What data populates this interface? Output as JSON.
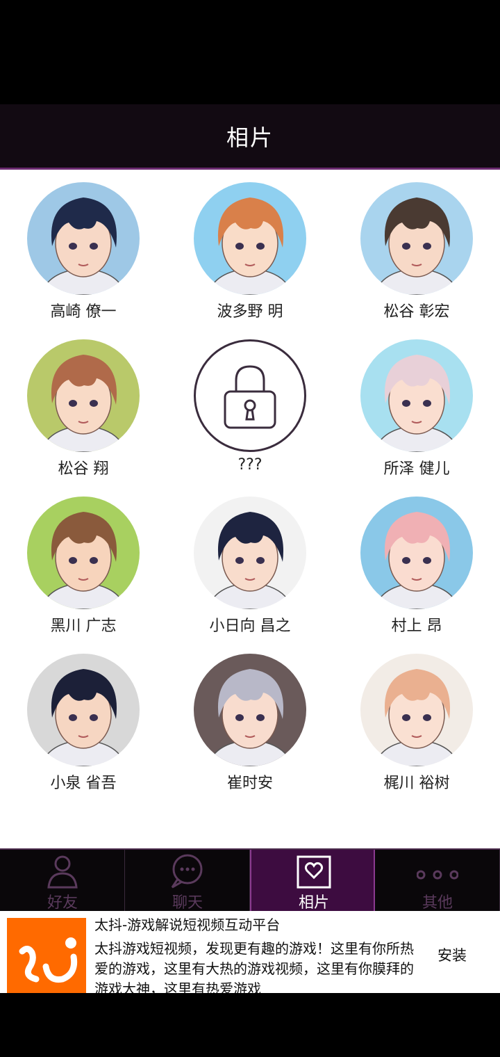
{
  "header": {
    "title": "相片"
  },
  "gallery": [
    {
      "name": "高崎 僚一",
      "hair": "#1f2a4a",
      "bg": "#9ec8e6",
      "skin": "#f7d8c6"
    },
    {
      "name": "波多野 明",
      "hair": "#d9804a",
      "bg": "#8fd0f0",
      "skin": "#f9dcc8"
    },
    {
      "name": "松谷 彰宏",
      "hair": "#4a3a32",
      "bg": "#a9d4ee",
      "skin": "#f7d9c7"
    },
    {
      "name": "松谷 翔",
      "hair": "#b06a4a",
      "bg": "#b9c96a",
      "skin": "#f8dac6"
    },
    {
      "name": "???",
      "locked": true
    },
    {
      "name": "所泽 健儿",
      "hair": "#e8d0d8",
      "bg": "#a8e0f0",
      "skin": "#faded0"
    },
    {
      "name": "黑川 广志",
      "hair": "#8a5a3c",
      "bg": "#a8d060",
      "skin": "#f7d4bc"
    },
    {
      "name": "小日向 昌之",
      "hair": "#1e2440",
      "bg": "#f2f2f2",
      "skin": "#f8dccc"
    },
    {
      "name": "村上 昂",
      "hair": "#f0b0b4",
      "bg": "#8ac8e8",
      "skin": "#fadcd0"
    },
    {
      "name": "小泉 省吾",
      "hair": "#1c2038",
      "bg": "#d8d8d8",
      "skin": "#f6d6c2"
    },
    {
      "name": "崔时安",
      "hair": "#b8b8c8",
      "bg": "#6a5a5a",
      "skin": "#f8dcce"
    },
    {
      "name": "梶川 裕树",
      "hair": "#eab090",
      "bg": "#f2ece6",
      "skin": "#fae0d2"
    }
  ],
  "tabs": [
    {
      "label": "好友",
      "icon": "person-icon",
      "active": false
    },
    {
      "label": "聊天",
      "icon": "chat-bubble-icon",
      "active": false
    },
    {
      "label": "相片",
      "icon": "heart-photo-icon",
      "active": true
    },
    {
      "label": "其他",
      "icon": "more-dots-icon",
      "active": false
    }
  ],
  "ad": {
    "title": "太抖-游戏解说短视频互动平台",
    "description": "太抖游戏短视频，发现更有趣的游戏！这里有你所热爱的游戏，这里有大热的游戏视频，这里有你膜拜的游戏大神，这里有热爱游戏",
    "install_label": "安装",
    "logo_color": "#ff6a00"
  }
}
